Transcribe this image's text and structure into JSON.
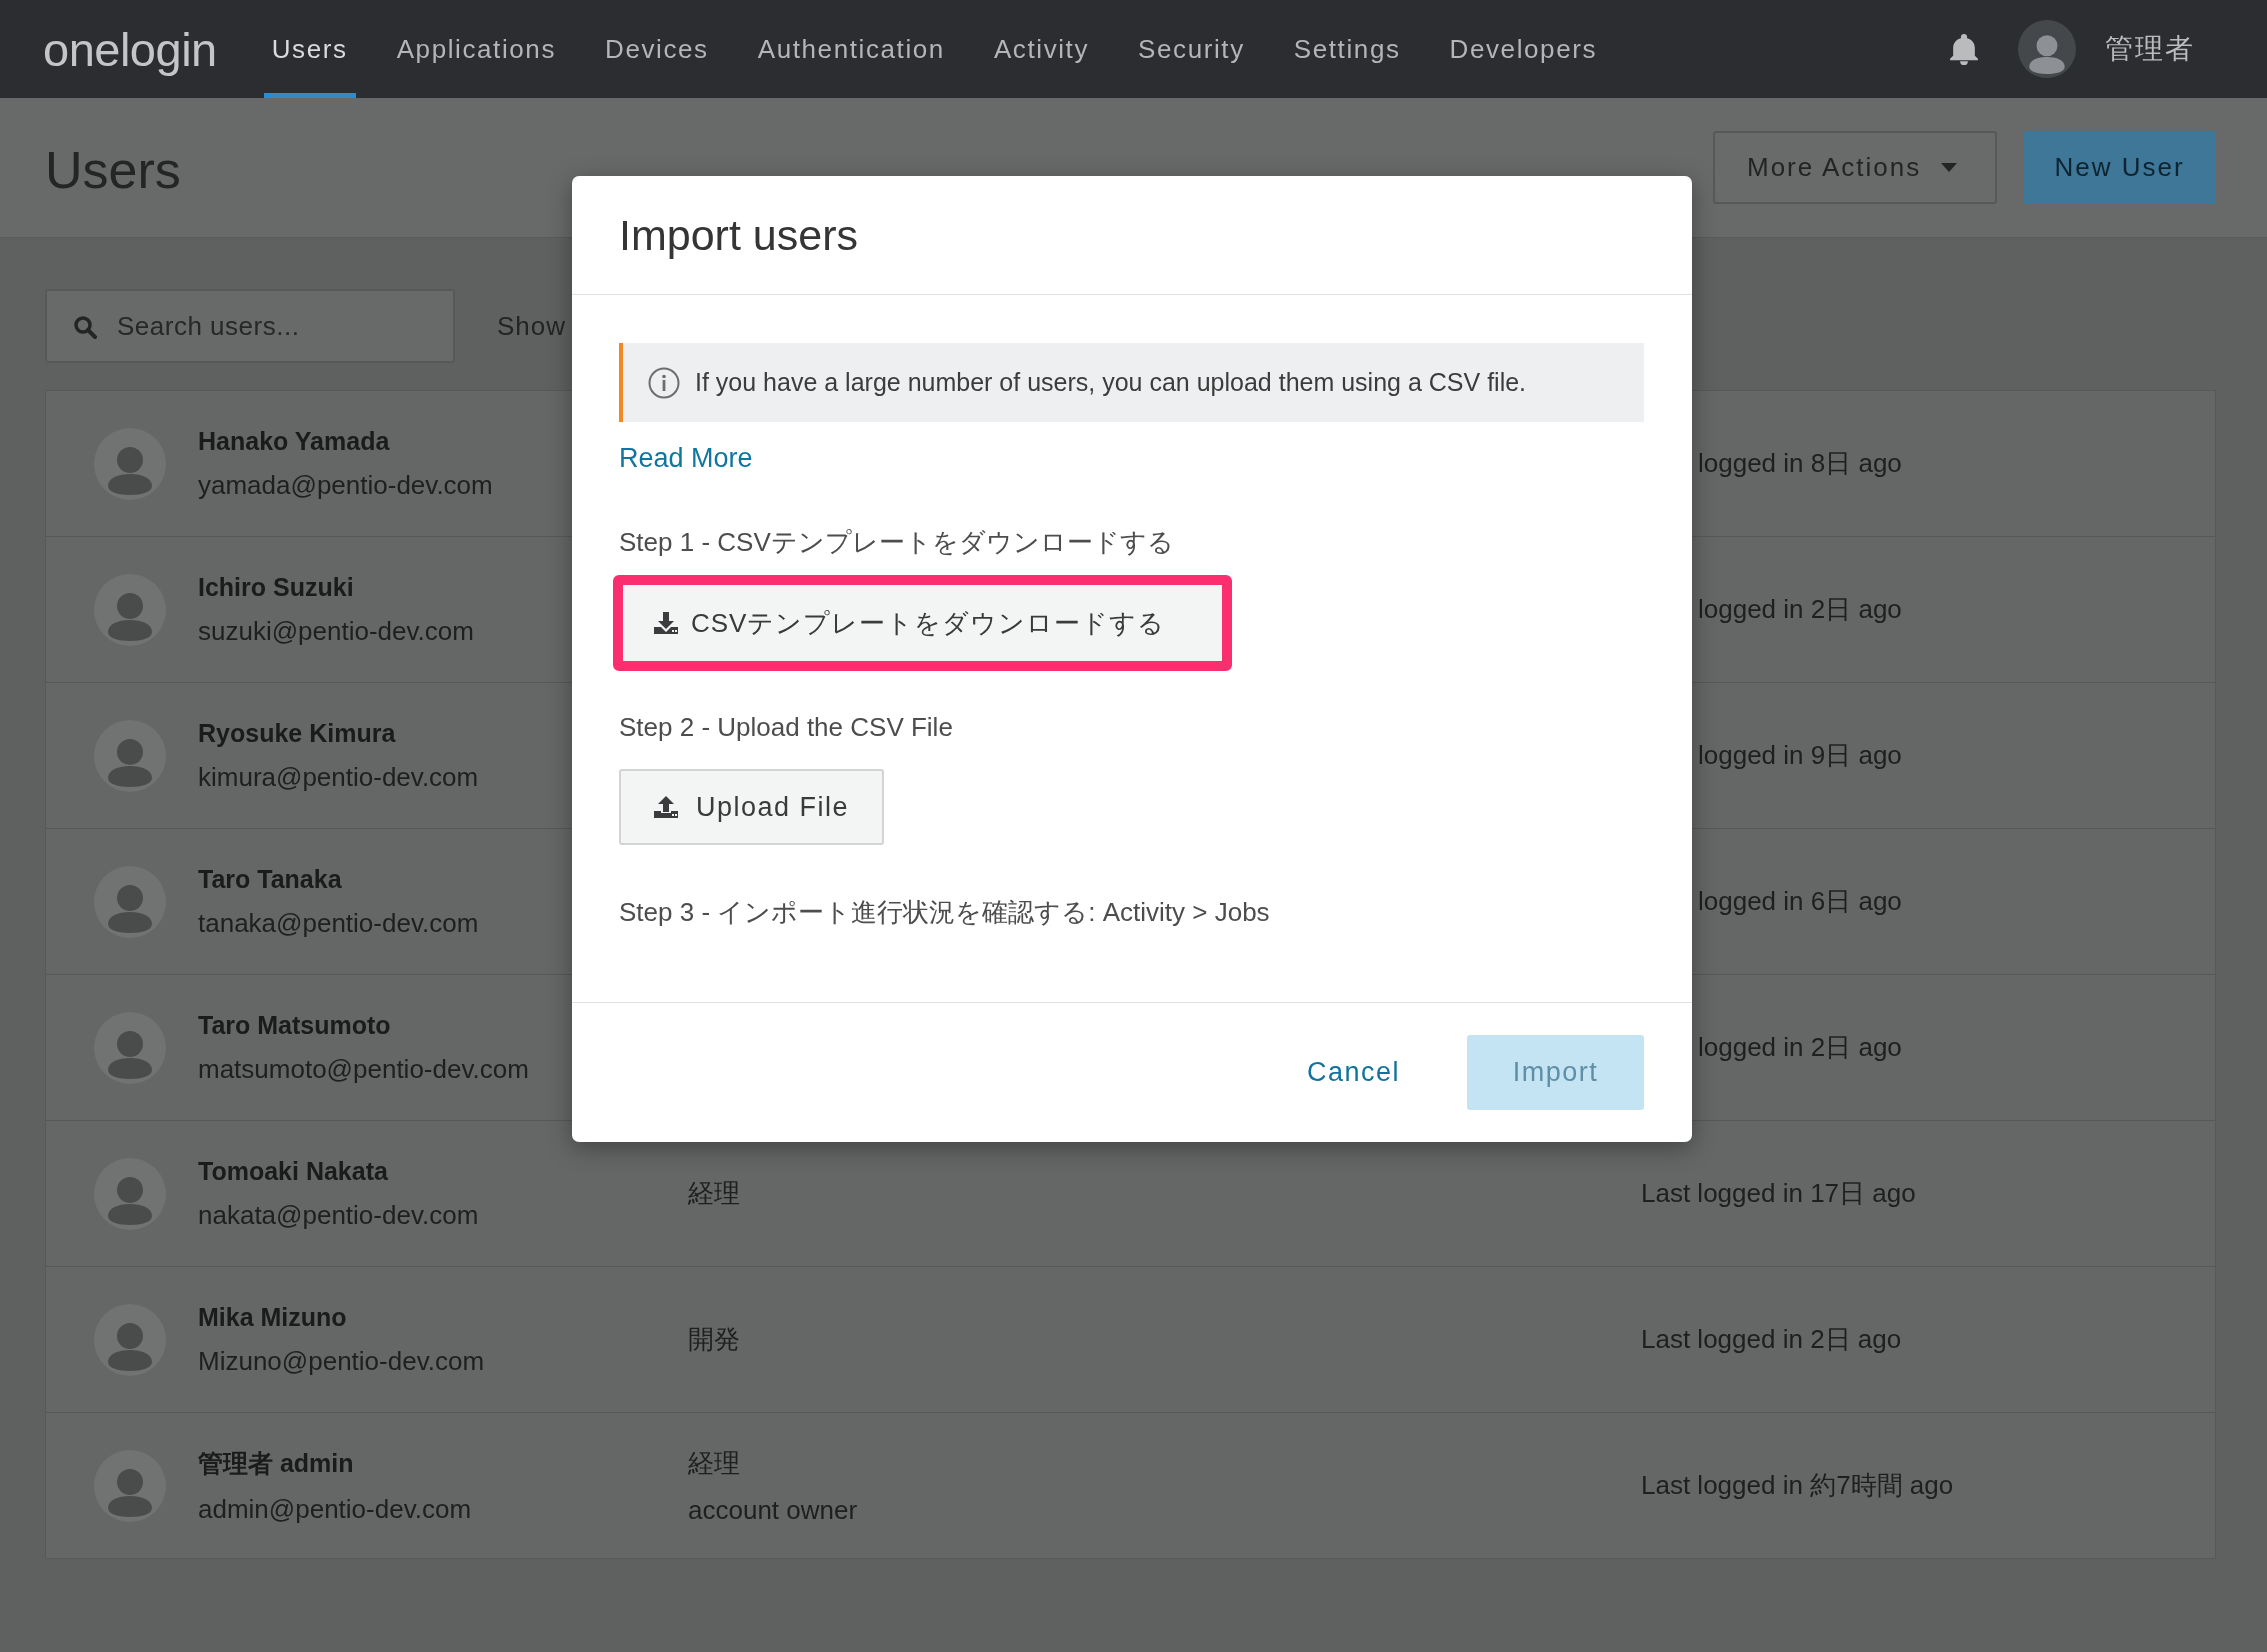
{
  "header": {
    "logo": "onelogin",
    "nav": [
      {
        "label": "Users",
        "selected": true
      },
      {
        "label": "Applications",
        "selected": false
      },
      {
        "label": "Devices",
        "selected": false
      },
      {
        "label": "Authentication",
        "selected": false
      },
      {
        "label": "Activity",
        "selected": false
      },
      {
        "label": "Security",
        "selected": false
      },
      {
        "label": "Settings",
        "selected": false
      },
      {
        "label": "Developers",
        "selected": false
      }
    ],
    "account_name": "管理者"
  },
  "page": {
    "title": "Users",
    "actions": [
      {
        "label": "More Actions",
        "kind": "dropdown"
      },
      {
        "label": "New User",
        "kind": "primary"
      }
    ]
  },
  "filters": {
    "search": {
      "placeholder": "Search users..."
    },
    "show_label": "Show"
  },
  "users": [
    {
      "name": "Hanako Yamada",
      "email": "yamada@pentio-dev.com",
      "last_login": "logged in 8日 ago",
      "behind_dialog": true
    },
    {
      "name": "Ichiro Suzuki",
      "email": "suzuki@pentio-dev.com",
      "last_login": "logged in 2日 ago",
      "behind_dialog": true
    },
    {
      "name": "Ryosuke Kimura",
      "email": "kimura@pentio-dev.com",
      "last_login": "logged in 9日 ago",
      "behind_dialog": true
    },
    {
      "name": "Taro Tanaka",
      "email": "tanaka@pentio-dev.com",
      "last_login": "logged in 6日 ago",
      "behind_dialog": true
    },
    {
      "name": "Taro Matsumoto",
      "email": "matsumoto@pentio-dev.com",
      "last_login": "logged in 2日 ago",
      "behind_dialog": true
    },
    {
      "name": "Tomoaki Nakata",
      "email": "nakata@pentio-dev.com",
      "department": "経理",
      "last_login": "Last logged in 17日 ago",
      "behind_dialog": false
    },
    {
      "name": "Mika Mizuno",
      "email": "Mizuno@pentio-dev.com",
      "department": "開発",
      "last_login": "Last logged in 2日 ago",
      "behind_dialog": false
    },
    {
      "name": "管理者 admin",
      "email": "admin@pentio-dev.com",
      "department": "経理",
      "role": "account owner",
      "last_login": "Last logged in 約7時間 ago",
      "behind_dialog": false
    }
  ],
  "dialog": {
    "title": "Import users",
    "notice": "If you have a large number of users, you can upload them using a CSV file.",
    "read_more": "Read More",
    "steps": [
      {
        "label": "Step 1 - CSVテンプレートをダウンロードする",
        "button": {
          "label": "CSVテンプレートをダウンロードする",
          "kind": "download",
          "highlighted": true
        }
      },
      {
        "label": "Step 2 - Upload the CSV File",
        "button": {
          "label": "Upload File",
          "kind": "upload",
          "highlighted": false
        }
      },
      {
        "label": "Step 3 - インポート進行状況を確認する: Activity > Jobs"
      }
    ],
    "cancel": "Cancel",
    "import": {
      "label": "Import",
      "disabled": true
    }
  }
}
